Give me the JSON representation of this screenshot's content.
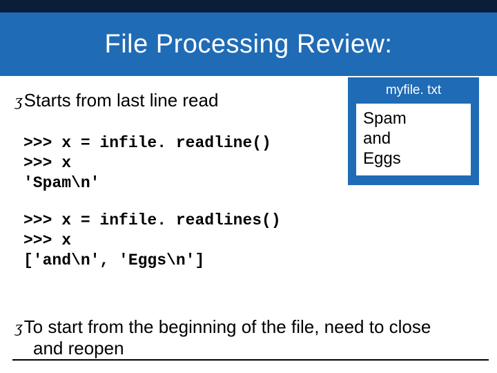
{
  "title": "File Processing Review:",
  "bullet1": "Starts from last line read",
  "code1_line1": ">>> x = infile. readline()",
  "code1_line2": ">>> x",
  "code1_line3": "'Spam\\n'",
  "code2_line1": ">>> x = infile. readlines()",
  "code2_line2": ">>> x",
  "code2_line3": "['and\\n', 'Eggs\\n']",
  "file": {
    "name": "myfile. txt",
    "line1": "Spam",
    "line2": "and",
    "line3": "Eggs"
  },
  "bullet2_part1": "To start from the beginning of the file, need to close",
  "bullet2_part2": "and reopen",
  "bullet_glyph": "ʒ"
}
